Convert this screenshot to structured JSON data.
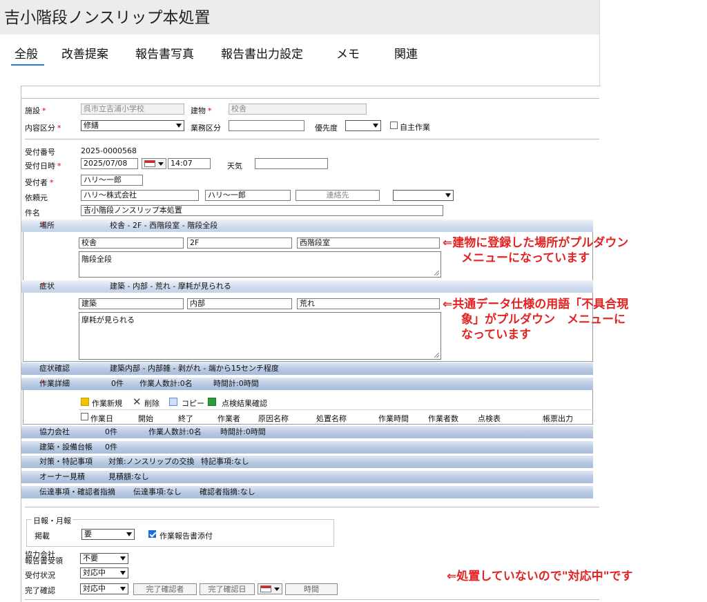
{
  "window": {
    "title": "吉小階段ノンスリップ本処置"
  },
  "tabs": [
    {
      "label": "全般",
      "active": true
    },
    {
      "label": "改善提案"
    },
    {
      "label": "報告書写真"
    },
    {
      "label": "報告書出力設定"
    },
    {
      "label": "メモ"
    },
    {
      "label": "関連"
    }
  ],
  "form": {
    "facility_label": "施設",
    "facility_value": "呉市立吉浦小学校",
    "building_label": "建物",
    "building_value": "校舎",
    "content_label": "内容区分",
    "content_value": "修繕",
    "business_label": "業務区分",
    "business_value": "",
    "priority_label": "優先度",
    "priority_value": "",
    "self_work_label": "自主作業",
    "receipt_no_label": "受付番号",
    "receipt_no_value": "2025-0000568",
    "receipt_date_label": "受付日時",
    "receipt_date_value": "2025/07/08",
    "receipt_time_value": "14:07",
    "weather_label": "天気",
    "weather_value": "",
    "receiver_label": "受付者",
    "receiver_value": "ハリ～一郎",
    "requester_label": "依頼元",
    "requester_company": "ハリ～株式会社",
    "requester_person": "ハリ～一郎",
    "contact_placeholder": "連絡先",
    "requester_select_value": "",
    "subject_label": "件名",
    "subject_value": "吉小階段ノンスリップ本処置"
  },
  "location": {
    "label": "場所",
    "summary": "校舎 - 2F - 西階段室 - 階段全段",
    "f1": "校舎",
    "f2": "2F",
    "f3": "西階段室",
    "detail": "階段全段"
  },
  "symptom": {
    "label": "症状",
    "summary": "建築 - 内部 - 荒れ - 摩耗が見られる",
    "f1": "建築",
    "f2": "内部",
    "f3": "荒れ",
    "detail": "摩耗が見られる"
  },
  "symptom_confirm": {
    "label": "症状確認",
    "value": "建築内部 - 内部雑 - 剥がれ - 端から15センチ程度"
  },
  "work_detail": {
    "label": "作業詳細",
    "count": "0件",
    "workers": "作業人数計:0名",
    "hours": "時間計:0時間",
    "toolbar": {
      "new": "作業新規",
      "delete": "削除",
      "copy": "コピー",
      "inspect": "点検結果確認"
    },
    "columns": [
      "作業日",
      "開始",
      "終了",
      "作業者",
      "原因名称",
      "処置名称",
      "作業時間",
      "作業者数",
      "点検表",
      "帳票出力"
    ]
  },
  "partner": {
    "label": "協力会社",
    "count": "0件",
    "workers": "作業人数計:0名",
    "hours": "時間計:0時間"
  },
  "ledger": {
    "label": "建築・設備台帳",
    "count": "0件"
  },
  "measures": {
    "label": "対策・特記事項",
    "measure": "対策:ノンスリップの交換",
    "note": "特記事項:なし"
  },
  "owner_estimate": {
    "label": "オーナー見積",
    "value": "見積額:なし"
  },
  "message": {
    "label": "伝達事項・確認者指摘",
    "message": "伝達事項:なし",
    "comment": "確認者指摘:なし"
  },
  "report": {
    "group_label": "日報・月報",
    "publish_label": "掲載",
    "publish_value": "要",
    "attach_label": "作業報告書添付",
    "attach_checked": true
  },
  "bottom": {
    "partner_report_label_1": "協力会社",
    "partner_report_label_2": "報告書受領",
    "partner_report_value": "不要",
    "status_label": "受付状況",
    "status_value": "対応中",
    "complete_label": "完了確認",
    "complete_value": "対応中",
    "confirmer_placeholder": "完了確認者",
    "confirm_date_placeholder": "完了確認日",
    "time_placeholder": "時間"
  },
  "annotations": {
    "a1_line1": "⇐建物に登録した場所がプルダウン",
    "a1_line2": "メニューになっています",
    "a2_line1": "⇐共通データ仕様の用語「不具合現",
    "a2_line2": "象」がプルダウン　メニューに",
    "a2_line3": "なっています",
    "a3": "⇐処置していないので\"対応中\"です"
  },
  "colors": {
    "required": "#d40000",
    "annotation": "#e32222",
    "tab_active": "#2a7bd4",
    "band": "#b7c8e2"
  }
}
